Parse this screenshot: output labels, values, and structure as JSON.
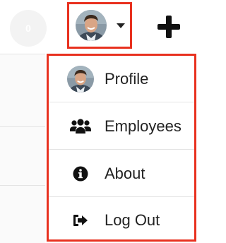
{
  "header": {
    "notification_count": "0",
    "avatar_icon": "user-avatar",
    "caret_icon": "caret-down",
    "add_icon": "plus"
  },
  "user_menu": {
    "items": [
      {
        "label": "Profile",
        "icon": "user-avatar"
      },
      {
        "label": "Employees",
        "icon": "users-group"
      },
      {
        "label": "About",
        "icon": "info-circle"
      },
      {
        "label": "Log Out",
        "icon": "sign-out"
      }
    ]
  },
  "colors": {
    "highlight": "#e8311f",
    "text": "#222222",
    "divider": "#e4e4e4"
  }
}
